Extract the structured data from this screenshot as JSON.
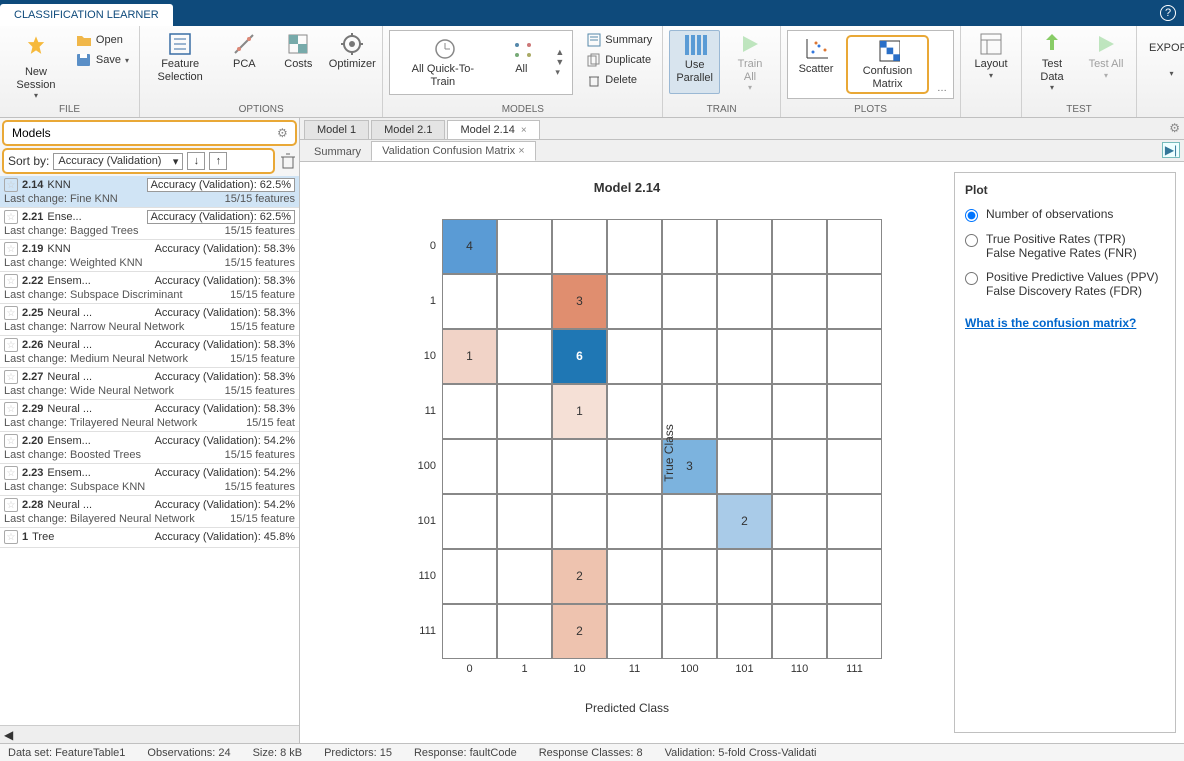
{
  "app_tab": "CLASSIFICATION LEARNER",
  "ribbon": {
    "file": {
      "label": "FILE",
      "new_session": "New\nSession",
      "open": "Open",
      "save": "Save"
    },
    "options": {
      "label": "OPTIONS",
      "feature_selection": "Feature\nSelection",
      "pca": "PCA",
      "costs": "Costs",
      "optimizer": "Optimizer"
    },
    "models": {
      "label": "MODELS",
      "all_quick": "All Quick-To-\nTrain",
      "all": "All"
    },
    "models_side": {
      "summary": "Summary",
      "duplicate": "Duplicate",
      "delete": "Delete"
    },
    "train": {
      "label": "TRAIN",
      "use_parallel": "Use\nParallel",
      "train_all": "Train\nAll"
    },
    "plots": {
      "label": "PLOTS",
      "scatter": "Scatter",
      "confusion": "Confusion\nMatrix"
    },
    "layout": "Layout",
    "test": {
      "label": "TEST",
      "test_data": "Test\nData",
      "test_all": "Test\nAll"
    },
    "export": "EXPORT"
  },
  "sidebar": {
    "title": "Models",
    "sort_by": "Sort by:",
    "sort_value": "Accuracy (Validation)",
    "items": [
      {
        "id": "2.14",
        "name": "KNN",
        "acc": "Accuracy (Validation): 62.5%",
        "box": true,
        "change": "Last change: Fine KNN",
        "feat": "15/15 features",
        "selected": true
      },
      {
        "id": "2.21",
        "name": "Ense...",
        "acc": "Accuracy (Validation): 62.5%",
        "box": true,
        "change": "Last change: Bagged Trees",
        "feat": "15/15 features"
      },
      {
        "id": "2.19",
        "name": "KNN",
        "acc": "Accuracy (Validation): 58.3%",
        "change": "Last change: Weighted KNN",
        "feat": "15/15 features"
      },
      {
        "id": "2.22",
        "name": "Ensem...",
        "acc": "Accuracy (Validation): 58.3%",
        "change": "Last change: Subspace Discriminant",
        "feat": "15/15 feature"
      },
      {
        "id": "2.25",
        "name": "Neural ...",
        "acc": "Accuracy (Validation): 58.3%",
        "change": "Last change: Narrow Neural Network",
        "feat": "15/15 feature"
      },
      {
        "id": "2.26",
        "name": "Neural ...",
        "acc": "Accuracy (Validation): 58.3%",
        "change": "Last change: Medium Neural Network",
        "feat": "15/15 feature"
      },
      {
        "id": "2.27",
        "name": "Neural ...",
        "acc": "Accuracy (Validation): 58.3%",
        "change": "Last change: Wide Neural Network",
        "feat": "15/15 features"
      },
      {
        "id": "2.29",
        "name": "Neural ...",
        "acc": "Accuracy (Validation): 58.3%",
        "change": "Last change: Trilayered Neural Network",
        "feat": "15/15 feat"
      },
      {
        "id": "2.20",
        "name": "Ensem...",
        "acc": "Accuracy (Validation): 54.2%",
        "change": "Last change: Boosted Trees",
        "feat": "15/15 features"
      },
      {
        "id": "2.23",
        "name": "Ensem...",
        "acc": "Accuracy (Validation): 54.2%",
        "change": "Last change: Subspace KNN",
        "feat": "15/15 features"
      },
      {
        "id": "2.28",
        "name": "Neural ...",
        "acc": "Accuracy (Validation): 54.2%",
        "change": "Last change: Bilayered Neural Network",
        "feat": "15/15 feature"
      },
      {
        "id": "1",
        "name": "Tree",
        "acc": "Accuracy (Validation): 45.8%",
        "change": "",
        "feat": ""
      }
    ]
  },
  "doc_tabs": [
    "Model 1",
    "Model 2.1",
    "Model 2.14"
  ],
  "sub_tabs": {
    "summary": "Summary",
    "vcm": "Validation Confusion Matrix"
  },
  "chart": {
    "title": "Model 2.14",
    "ylabel": "True Class",
    "xlabel": "Predicted Class"
  },
  "chart_data": {
    "type": "heatmap",
    "title": "Model 2.14",
    "xlabel": "Predicted Class",
    "ylabel": "True Class",
    "categories": [
      "0",
      "1",
      "10",
      "11",
      "100",
      "101",
      "110",
      "111"
    ],
    "matrix": [
      [
        4,
        null,
        null,
        null,
        null,
        null,
        null,
        null
      ],
      [
        null,
        null,
        3,
        null,
        null,
        null,
        null,
        null
      ],
      [
        1,
        null,
        6,
        null,
        null,
        null,
        null,
        null
      ],
      [
        null,
        null,
        1,
        null,
        null,
        null,
        null,
        null
      ],
      [
        null,
        null,
        null,
        null,
        3,
        null,
        null,
        null
      ],
      [
        null,
        null,
        null,
        null,
        null,
        2,
        null,
        null
      ],
      [
        null,
        null,
        2,
        null,
        null,
        null,
        null,
        null
      ],
      [
        null,
        null,
        2,
        null,
        null,
        null,
        null,
        null
      ]
    ],
    "colors": [
      [
        "#5a9bd5",
        "",
        "",
        "",
        "",
        "",
        "",
        ""
      ],
      [
        "",
        "",
        "#e08e6f",
        "",
        "",
        "",
        "",
        ""
      ],
      [
        "#f1d3c7",
        "",
        "#1f77b4",
        "",
        "",
        "",
        "",
        ""
      ],
      [
        "",
        "",
        "#f5e0d6",
        "",
        "",
        "",
        "",
        ""
      ],
      [
        "",
        "",
        "",
        "",
        "#7cb3de",
        "",
        "",
        ""
      ],
      [
        "",
        "",
        "",
        "",
        "",
        "#a9cbe8",
        "",
        ""
      ],
      [
        "",
        "",
        "#eec3af",
        "",
        "",
        "",
        "",
        ""
      ],
      [
        "",
        "",
        "#eec3af",
        "",
        "",
        "",
        "",
        ""
      ]
    ]
  },
  "options": {
    "title": "Plot",
    "opt1": "Number of observations",
    "opt2a": "True Positive Rates (TPR)",
    "opt2b": "False Negative Rates (FNR)",
    "opt3a": "Positive Predictive Values (PPV)",
    "opt3b": "False Discovery Rates (FDR)",
    "link": "What is the confusion matrix?"
  },
  "status": {
    "dataset": "Data set: FeatureTable1",
    "obs": "Observations: 24",
    "size": "Size: 8 kB",
    "predictors": "Predictors: 15",
    "response": "Response: faultCode",
    "classes": "Response Classes: 8",
    "validation": "Validation: 5-fold Cross-Validati"
  }
}
